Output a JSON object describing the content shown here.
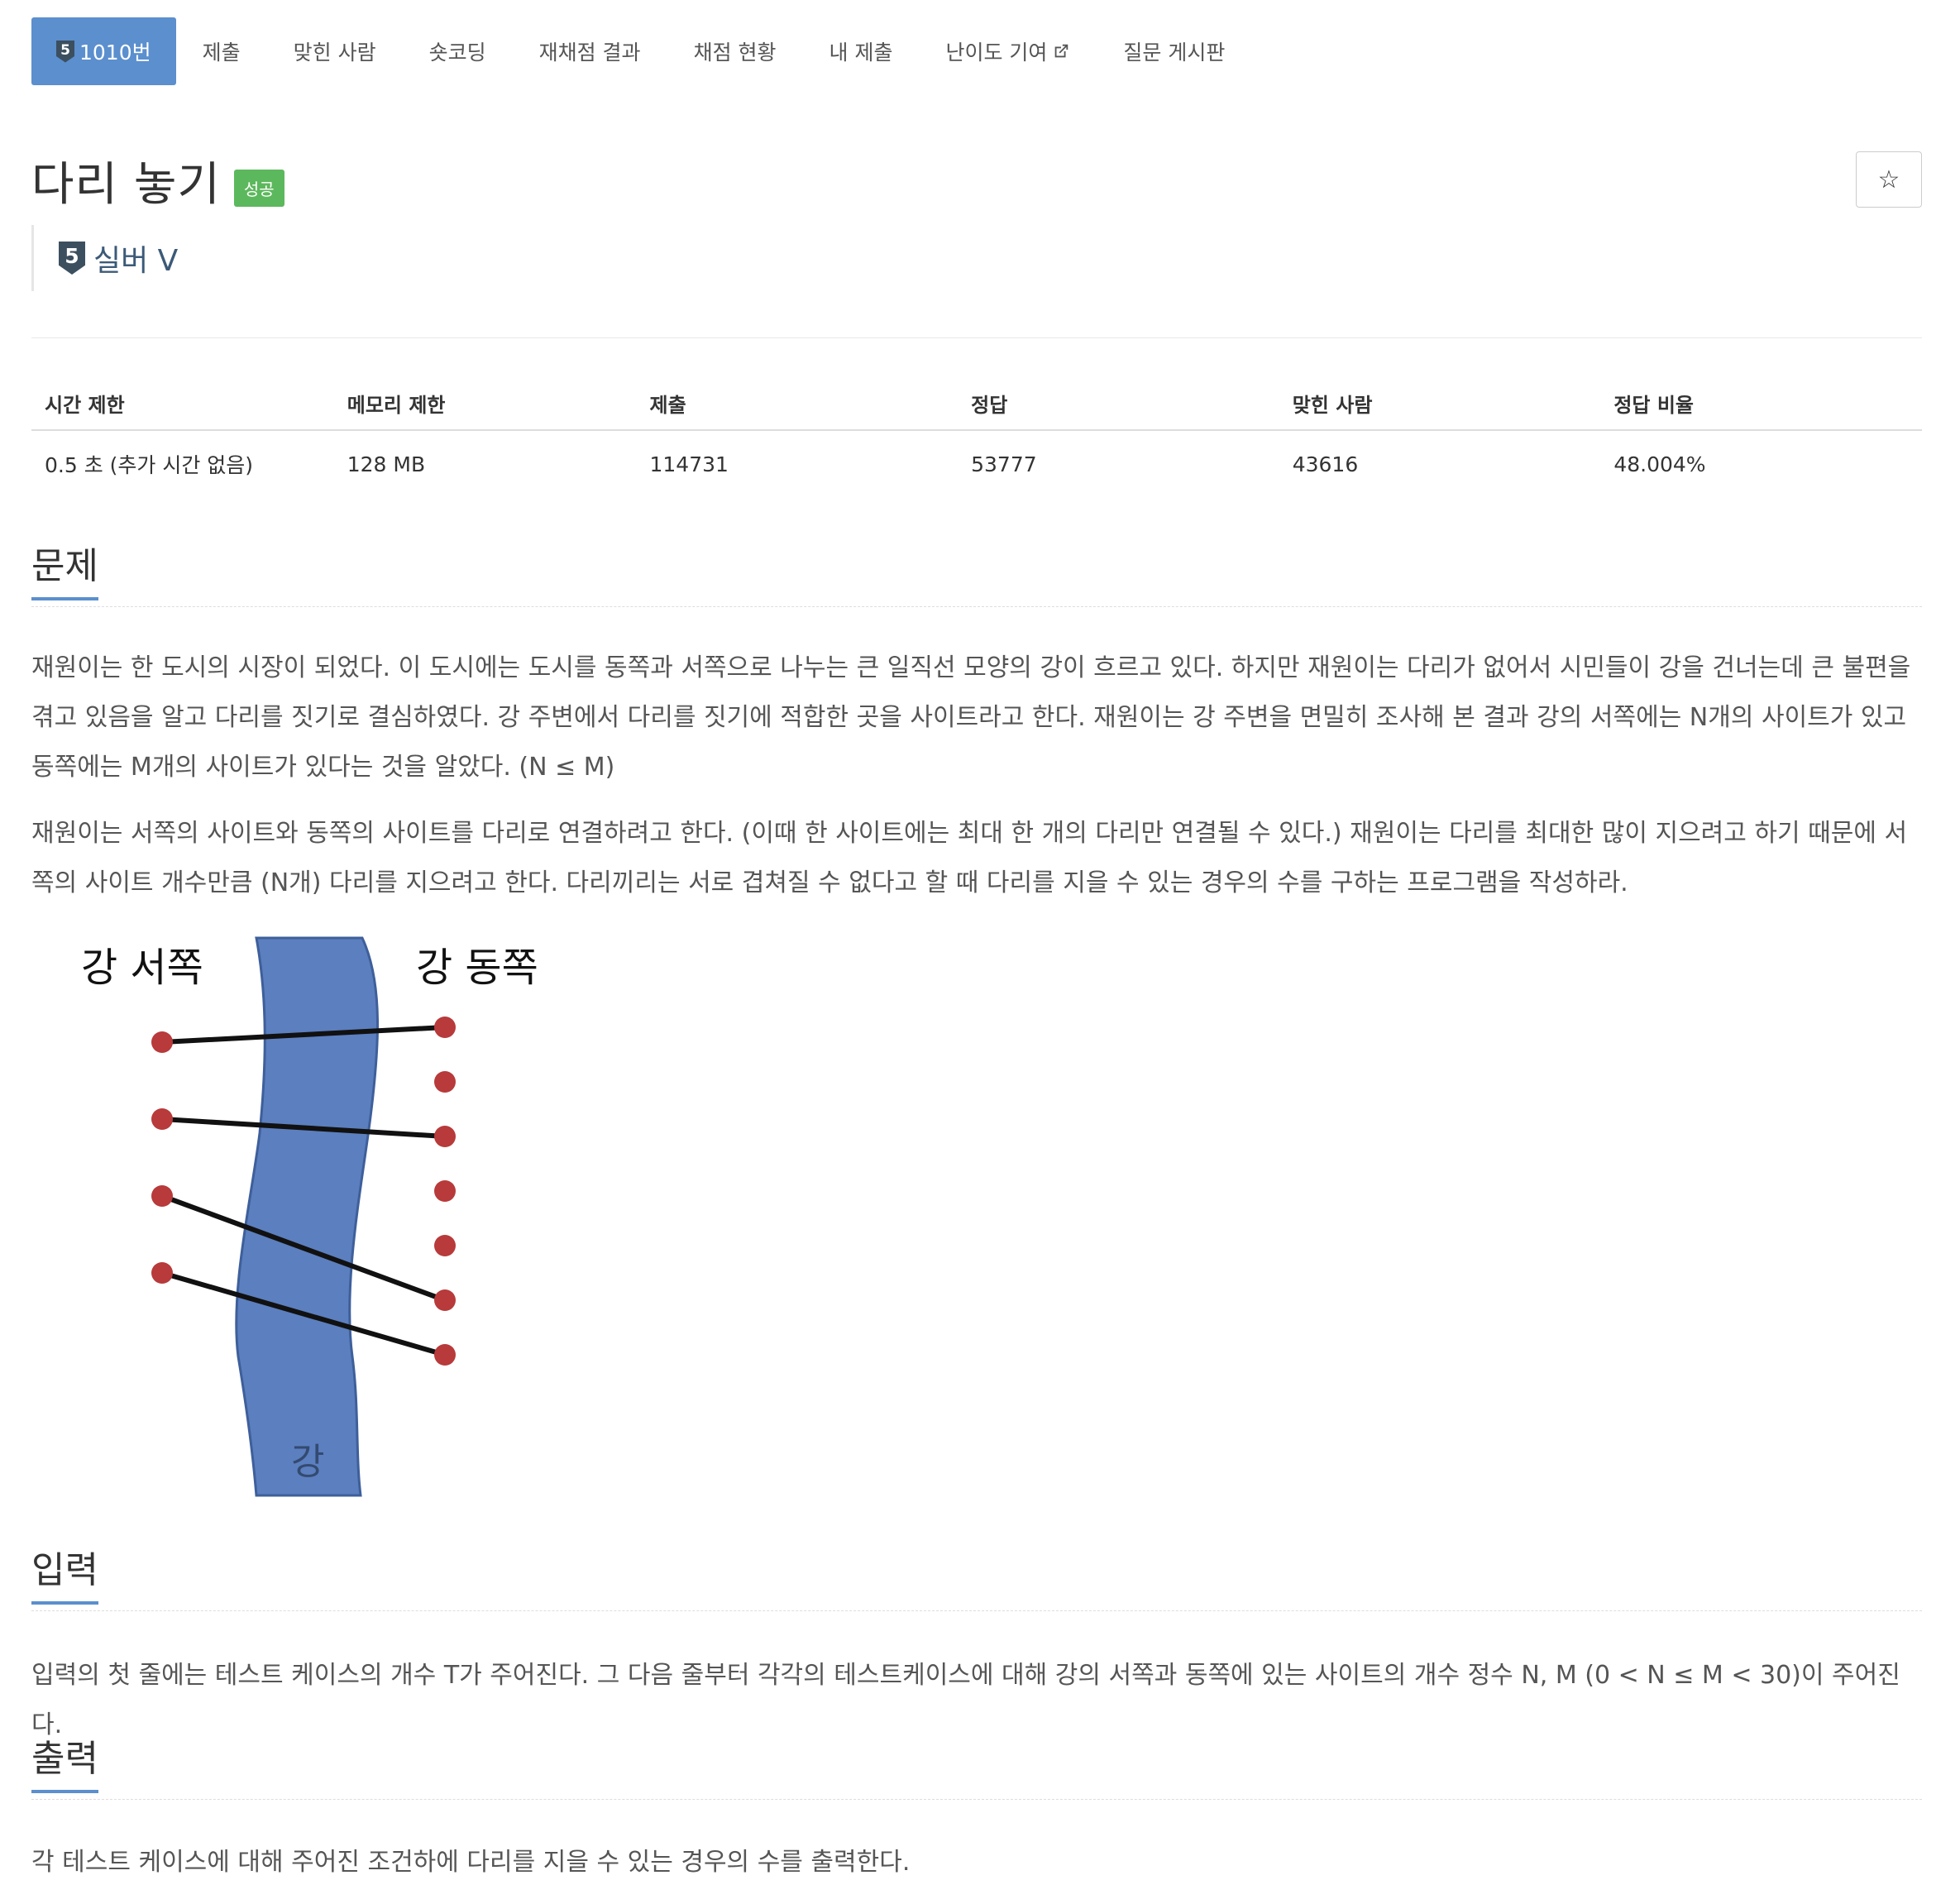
{
  "nav": {
    "items": [
      {
        "label": "1010번",
        "tier_digit": "5",
        "active": true
      },
      {
        "label": "제출"
      },
      {
        "label": "맞힌 사람"
      },
      {
        "label": "숏코딩"
      },
      {
        "label": "재채점 결과"
      },
      {
        "label": "채점 현황"
      },
      {
        "label": "내 제출"
      },
      {
        "label": "난이도 기여",
        "icon": "external-link-icon"
      },
      {
        "label": "질문 게시판"
      }
    ]
  },
  "problem": {
    "title": "다리 놓기",
    "status_badge": "성공",
    "star_icon": "☆",
    "tier": {
      "digit": "5",
      "label": "실버 V"
    }
  },
  "stats": {
    "headers": [
      "시간 제한",
      "메모리 제한",
      "제출",
      "정답",
      "맞힌 사람",
      "정답 비율"
    ],
    "values": [
      "0.5 초 (추가 시간 없음)",
      "128 MB",
      "114731",
      "53777",
      "43616",
      "48.004%"
    ]
  },
  "sections": {
    "problem": {
      "title": "문제",
      "paragraphs": [
        "재원이는 한 도시의 시장이 되었다. 이 도시에는 도시를 동쪽과 서쪽으로 나누는 큰 일직선 모양의 강이 흐르고 있다. 하지만 재원이는 다리가 없어서 시민들이 강을 건너는데 큰 불편을 겪고 있음을 알고 다리를 짓기로 결심하였다. 강 주변에서 다리를 짓기에 적합한 곳을 사이트라고 한다. 재원이는 강 주변을 면밀히 조사해 본 결과 강의 서쪽에는 N개의 사이트가 있고 동쪽에는 M개의 사이트가 있다는 것을 알았다. (N ≤ M)",
        "재원이는 서쪽의 사이트와 동쪽의 사이트를 다리로 연결하려고 한다. (이때 한 사이트에는 최대 한 개의 다리만 연결될 수 있다.) 재원이는 다리를 최대한 많이 지으려고 하기 때문에 서쪽의 사이트 개수만큼 (N개) 다리를 지으려고 한다. 다리끼리는 서로 겹쳐질 수 없다고 할 때 다리를 지을 수 있는 경우의 수를 구하는 프로그램을 작성하라."
      ],
      "figure": {
        "west_label": "강 서쪽",
        "east_label": "강 동쪽",
        "river_label": "강",
        "west_sites": 4,
        "east_sites": 7,
        "bridges": [
          [
            0,
            0
          ],
          [
            1,
            2
          ],
          [
            2,
            5
          ],
          [
            3,
            6
          ]
        ],
        "river_color": "#5b7fbf",
        "site_color": "#b83a3a"
      }
    },
    "input": {
      "title": "입력",
      "text": "입력의 첫 줄에는 테스트 케이스의 개수 T가 주어진다. 그 다음 줄부터 각각의 테스트케이스에 대해 강의 서쪽과 동쪽에 있는 사이트의 개수 정수 N, M (0 < N ≤ M < 30)이 주어진다."
    },
    "output": {
      "title": "출력",
      "text": "각 테스트 케이스에 대해 주어진 조건하에 다리를 지을 수 있는 경우의 수를 출력한다."
    }
  },
  "colors": {
    "accent": "#5b8fce",
    "success": "#5cb85c",
    "tier": "#3c4f5f"
  }
}
